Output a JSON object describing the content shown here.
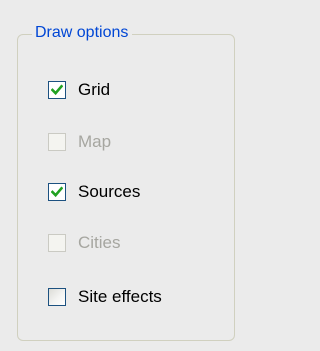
{
  "groupbox": {
    "title": "Draw options"
  },
  "options": [
    {
      "label": "Grid",
      "checked": true,
      "enabled": true
    },
    {
      "label": "Map",
      "checked": false,
      "enabled": false
    },
    {
      "label": "Sources",
      "checked": true,
      "enabled": true
    },
    {
      "label": "Cities",
      "checked": false,
      "enabled": false
    },
    {
      "label": "Site effects",
      "checked": false,
      "enabled": true
    }
  ],
  "colors": {
    "background": "#ebebeb",
    "group_title": "#0046d5",
    "check_mark": "#21a121",
    "checkbox_border": "#1c5180",
    "disabled_text": "#a6a6a0"
  }
}
